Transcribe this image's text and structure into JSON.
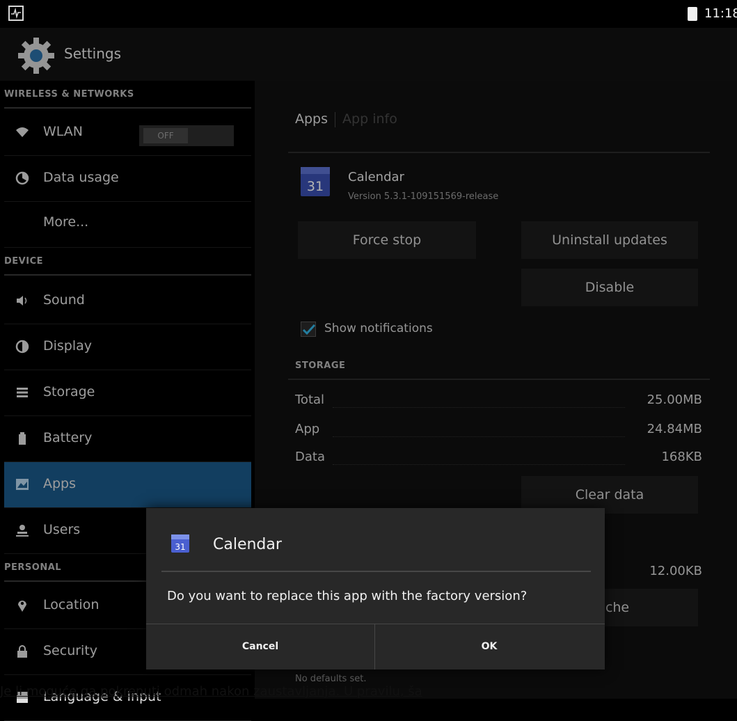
{
  "status_bar": {
    "time": "11:18"
  },
  "action_bar": {
    "title": "Settings"
  },
  "sidebar": {
    "wireless_header": "WIRELESS & NETWORKS",
    "wlan": {
      "label": "WLAN",
      "toggle_state": "OFF"
    },
    "data_usage": "Data usage",
    "more": "More...",
    "device_header": "DEVICE",
    "sound": "Sound",
    "display": "Display",
    "storage": "Storage",
    "battery": "Battery",
    "apps": "Apps",
    "users": "Users",
    "personal_header": "PERSONAL",
    "location": "Location",
    "security": "Security",
    "language": "Language & input"
  },
  "content": {
    "breadcrumb_apps": "Apps",
    "breadcrumb_info": "App info",
    "app_name": "Calendar",
    "app_version": "Version 5.3.1-109151569-release",
    "icon_day": "31",
    "force_stop": "Force stop",
    "uninstall_updates": "Uninstall updates",
    "disable": "Disable",
    "show_notifications": "Show notifications",
    "storage_header": "STORAGE",
    "total_label": "Total",
    "total_value": "25.00MB",
    "app_label": "App",
    "app_value": "24.84MB",
    "data_label": "Data",
    "data_value": "168KB",
    "clear_data": "Clear data",
    "cache_value": "12.00KB",
    "clear_cache_partial": "cache",
    "no_defaults": "No defaults set."
  },
  "dialog": {
    "title": "Calendar",
    "icon_day": "31",
    "message": "Do you want to replace this app with the factory version?",
    "cancel": "Cancel",
    "ok": "OK"
  },
  "caption": "Je li moguće ga pokrenuti odmah nakon zaustavljanja. U pravilu, ša"
}
